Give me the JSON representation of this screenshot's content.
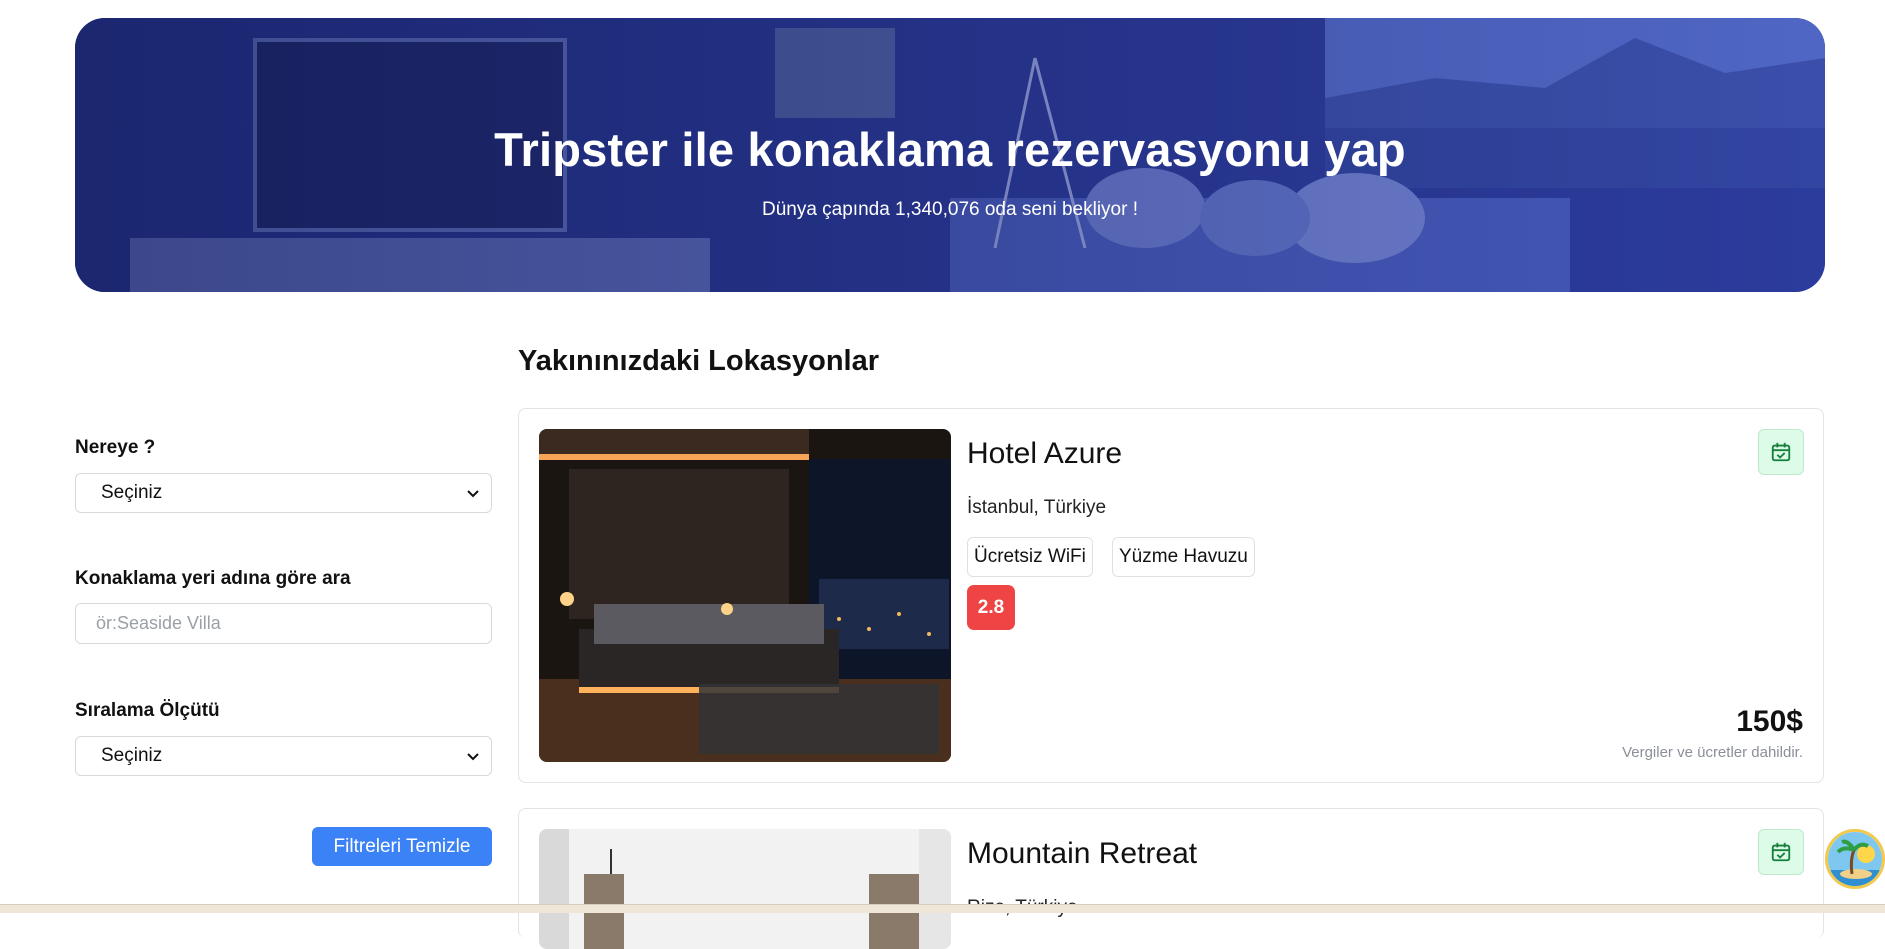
{
  "hero": {
    "title": "Tripster ile konaklama rezervasyonu yap",
    "subtitle": "Dünya çapında 1,340,076 oda seni bekliyor !"
  },
  "filters": {
    "destination_label": "Nereye ?",
    "destination_value": "Seçiniz",
    "name_search_label": "Konaklama yeri adına göre ara",
    "name_search_placeholder": "ör:Seaside Villa",
    "sort_label": "Sıralama Ölçütü",
    "sort_value": "Seçiniz",
    "clear_button": "Filtreleri Temizle"
  },
  "results": {
    "section_title": "Yakınınızdaki Lokasyonlar",
    "cards": [
      {
        "name": "Hotel Azure",
        "location": "İstanbul, Türkiye",
        "amenities": [
          "Ücretsiz WiFi",
          "Yüzme Havuzu"
        ],
        "rating": "2.8",
        "price": "150$",
        "price_note": "Vergiler ve ücretler dahildir.",
        "action_icon": "calendar-check-icon"
      },
      {
        "name": "Mountain Retreat",
        "location": "Rize, Türkiye",
        "action_icon": "calendar-check-icon"
      }
    ]
  },
  "colors": {
    "accent_blue": "#3b82f6",
    "rating_red": "#ef4444",
    "calendar_green_bg": "#dcfce7",
    "calendar_green_icon": "#15803d"
  },
  "floating_button_icon": "palm-island-icon"
}
